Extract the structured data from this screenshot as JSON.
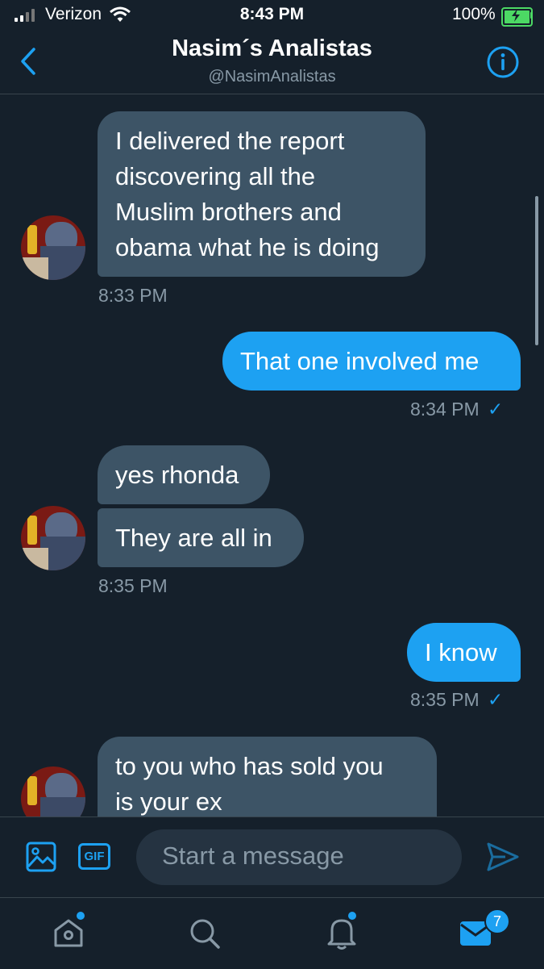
{
  "status_bar": {
    "carrier": "Verizon",
    "time": "8:43 PM",
    "battery": "100%"
  },
  "header": {
    "title": "Nasim´s Analistas",
    "handle": "@NasimAnalistas"
  },
  "messages": [
    {
      "direction": "in",
      "lines": [
        "I delivered the report",
        "discovering all the",
        "Muslim brothers and",
        "obama what he is doing"
      ]
    },
    {
      "direction": "in",
      "timestamp": "8:33 PM"
    },
    {
      "direction": "out",
      "text": "That one involved me",
      "timestamp": "8:34 PM"
    },
    {
      "direction": "in",
      "text": "yes rhonda"
    },
    {
      "direction": "in",
      "text": "They are all in",
      "timestamp": "8:35 PM"
    },
    {
      "direction": "out",
      "text": "I know",
      "timestamp": "8:35 PM"
    },
    {
      "direction": "in",
      "lines": [
        "to you who has sold you",
        "is your ex"
      ]
    }
  ],
  "read_mark": "✓",
  "compose": {
    "placeholder": "Start a message",
    "gif_label": "GIF"
  },
  "tab_bar": {
    "messages_badge": "7"
  },
  "colors": {
    "background": "#15202b",
    "incoming_bubble": "#3d5466",
    "outgoing_bubble": "#1da1f2",
    "accent": "#1da1f2",
    "muted_text": "#8899a6"
  },
  "icons": [
    "back-arrow-icon",
    "info-icon",
    "image-icon",
    "gif-icon",
    "send-icon",
    "home-icon",
    "search-icon",
    "notifications-icon",
    "messages-icon",
    "wifi-icon",
    "battery-charging-icon",
    "signal-icon"
  ]
}
